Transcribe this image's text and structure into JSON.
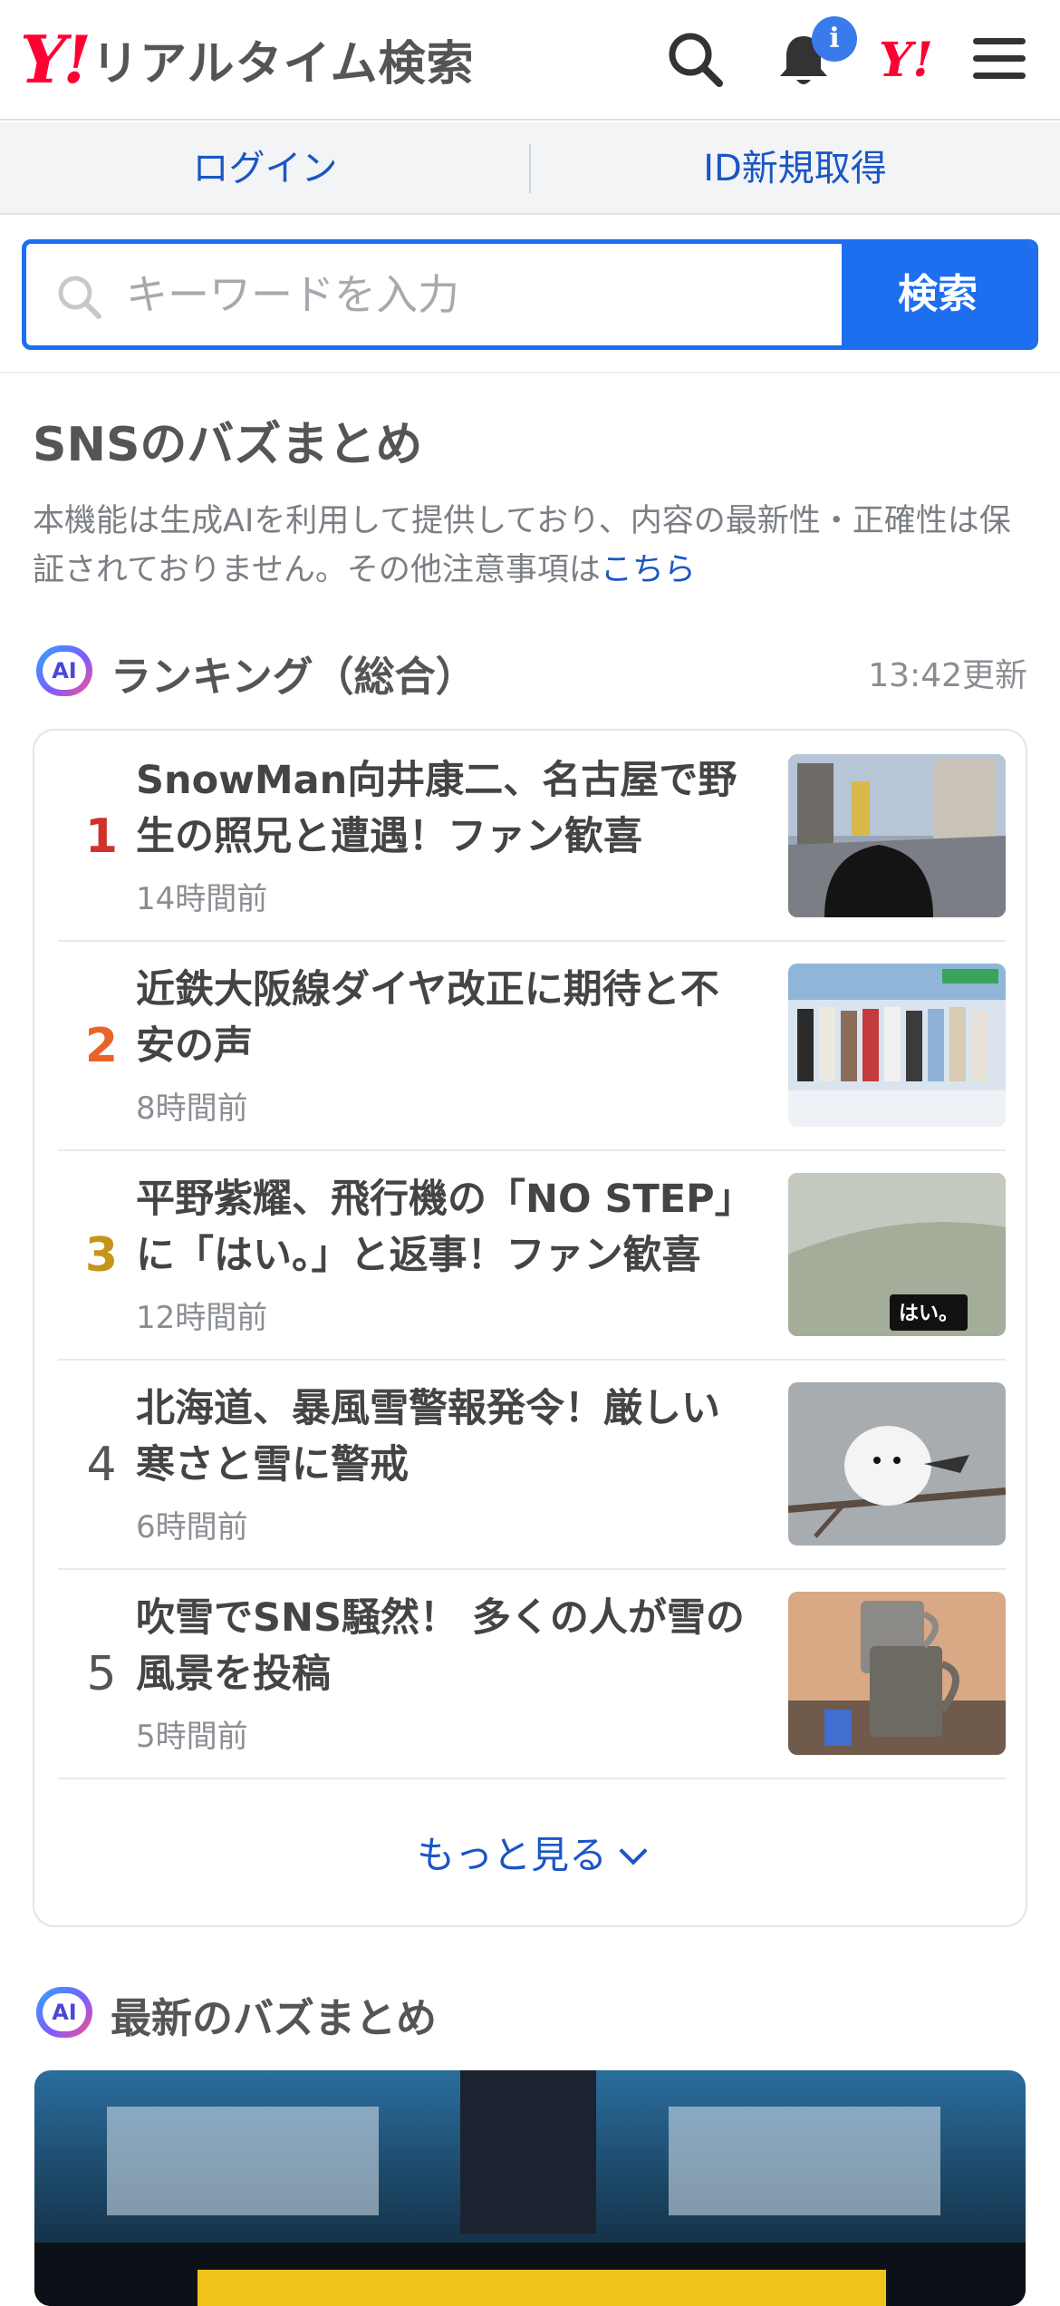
{
  "header": {
    "logo_mark": "Y!",
    "logo_text": "リアルタイム検索",
    "notification_badge": "i",
    "yahoo_mark": "Y!"
  },
  "account": {
    "login_label": "ログイン",
    "register_label": "ID新規取得"
  },
  "search": {
    "placeholder": "キーワードを入力",
    "button_label": "検索"
  },
  "buzz": {
    "title": "SNSのバズまとめ",
    "notice_text": "本機能は生成AIを利用して提供しており、内容の最新性・正確性は保証されておりません。その他注意事項は",
    "notice_link": "こちら"
  },
  "ranking": {
    "ai_label": "AI",
    "title": "ランキング（総合）",
    "updated": "13:42更新",
    "items": [
      {
        "rank": "1",
        "headline": "SnowMan向井康二、名古屋で野生の照兄と遭遇！ファン歓喜",
        "time": "14時間前",
        "rank_color": "#d0322b",
        "thumb": "city-street-plaza-photo"
      },
      {
        "rank": "2",
        "headline": "近鉄大阪線ダイヤ改正に期待と不安の声",
        "time": "8時間前",
        "rank_color": "#e8652a",
        "thumb": "group-on-tv-studio-photo"
      },
      {
        "rank": "3",
        "headline": "平野紫耀、飛行機の「NO STEP」に「はい。」と返事！ファン歓喜",
        "time": "12時間前",
        "rank_color": "#c69418",
        "thumb": "airplane-wing-photo",
        "thumb_caption": "はい。"
      },
      {
        "rank": "4",
        "headline": "北海道、暴風雪警報発令！厳しい寒さと雪に警戒",
        "time": "6時間前",
        "rank_color": "#555555",
        "thumb": "white-bird-on-branch-photo"
      },
      {
        "rank": "5",
        "headline": "吹雪でSNS騒然！ 多くの人が雪の風景を投稿",
        "time": "5時間前",
        "rank_color": "#555555",
        "thumb": "metal-mugs-photo"
      }
    ],
    "more_label": "もっと見る"
  },
  "latest": {
    "ai_label": "AI",
    "title": "最新のバズまとめ"
  },
  "colors": {
    "brand_red": "#ff0033",
    "accent_blue": "#1e6ef0",
    "link_blue": "#1a56c4"
  }
}
